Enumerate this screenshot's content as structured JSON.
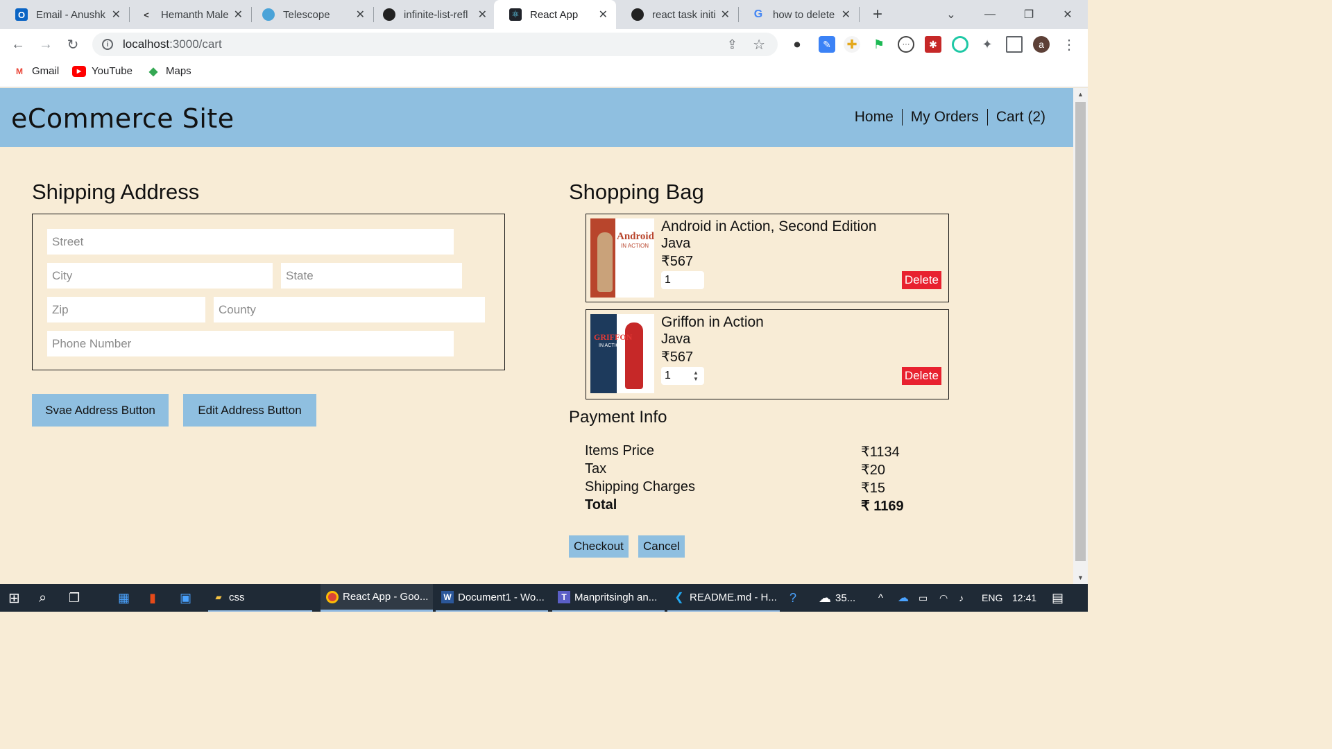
{
  "browser": {
    "tabs": [
      {
        "label": "Email - Anushk",
        "icon": "outlook-icon"
      },
      {
        "label": "Hemanth Male",
        "icon": "code-icon"
      },
      {
        "label": "Telescope",
        "icon": "telescope-icon"
      },
      {
        "label": "infinite-list-refl",
        "icon": "github-icon"
      },
      {
        "label": "React App",
        "icon": "react-icon"
      },
      {
        "label": "react task initia",
        "icon": "github-icon"
      },
      {
        "label": "how to delete",
        "icon": "google-icon"
      }
    ],
    "new_tab": "+",
    "url_host": "localhost",
    "url_path": ":3000/cart",
    "avatar_letter": "a",
    "bookmarks": [
      "Gmail",
      "YouTube",
      "Maps"
    ]
  },
  "site": {
    "title": "eCommerce Site",
    "nav": [
      "Home",
      "My Orders",
      "Cart (2)"
    ]
  },
  "shipping": {
    "heading": "Shipping Address",
    "placeholders": {
      "street": "Street",
      "city": "City",
      "state": "State",
      "zip": "Zip",
      "county": "County",
      "phone": "Phone Number"
    },
    "save_button": "Svae Address Button",
    "edit_button": "Edit Address Button"
  },
  "bag": {
    "heading": "Shopping Bag",
    "items": [
      {
        "title": "Android in Action, Second Edition",
        "category": "Java",
        "price": "₹567",
        "qty": "1",
        "delete": "Delete",
        "cover_text": "Android",
        "cover_sub": "IN ACTION"
      },
      {
        "title": "Griffon in Action",
        "category": "Java",
        "price": "₹567",
        "qty": "1",
        "delete": "Delete",
        "cover_text": "GRIFFON",
        "cover_sub": "IN ACTION"
      }
    ]
  },
  "payment": {
    "heading": "Payment Info",
    "rows": [
      {
        "label": "Items Price",
        "value": "₹1134"
      },
      {
        "label": "Tax",
        "value": "₹20"
      },
      {
        "label": "Shipping Charges",
        "value": "₹15"
      },
      {
        "label": "Total",
        "value": "₹ 1169"
      }
    ],
    "checkout": "Checkout",
    "cancel": "Cancel"
  },
  "taskbar": {
    "search": "",
    "items": [
      "css",
      "React App - Goo...",
      "Document1 - Wo...",
      "Manpritsingh an...",
      "README.md - H..."
    ],
    "weather": "35...",
    "lang": "ENG",
    "time": "12:41"
  },
  "colors": {
    "page_bg": "#f8ecd6",
    "header_bg": "#8fbfe0",
    "delete_red": "#e8212f"
  }
}
